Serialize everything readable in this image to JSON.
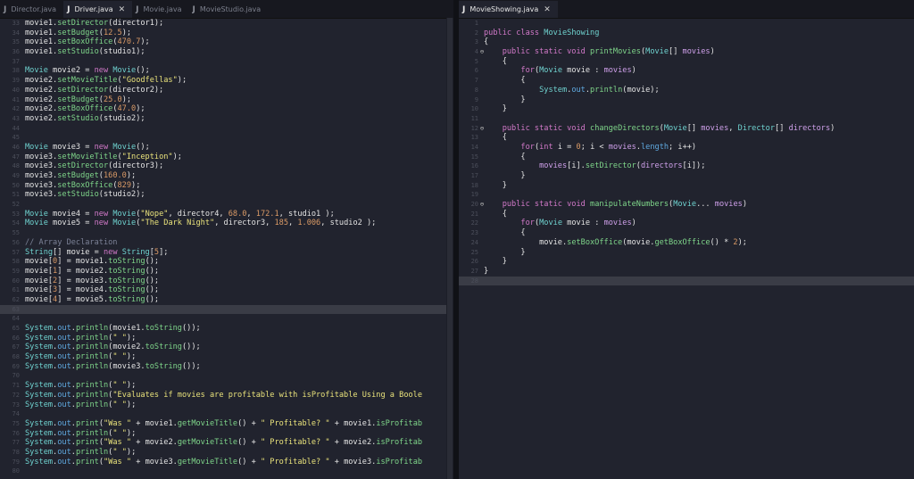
{
  "left_tabs": [
    {
      "label": "Director.java",
      "active": false,
      "close": false
    },
    {
      "label": "Driver.java",
      "active": true,
      "close": true
    },
    {
      "label": "Movie.java",
      "active": false,
      "close": false
    },
    {
      "label": "MovieStudio.java",
      "active": false,
      "close": false
    }
  ],
  "right_tabs": [
    {
      "label": "MovieShowing.java",
      "active": true,
      "close": true
    }
  ],
  "left_code": [
    {
      "n": "33",
      "h": "movie1.<span class=\"f\">setDirector</span>(director1);"
    },
    {
      "n": "34",
      "h": "movie1.<span class=\"f\">setBudget</span>(<span class=\"n\">12.5</span>);"
    },
    {
      "n": "35",
      "h": "movie1.<span class=\"f\">setBoxOffice</span>(<span class=\"n\">470.7</span>);"
    },
    {
      "n": "36",
      "h": "movie1.<span class=\"f\">setStudio</span>(studio1);"
    },
    {
      "n": "37",
      "h": ""
    },
    {
      "n": "38",
      "h": "<span class=\"t\">Movie</span> movie2 = <span class=\"k\">new</span> <span class=\"t\">Movie</span>();"
    },
    {
      "n": "39",
      "h": "movie2.<span class=\"f\">setMovieTitle</span>(<span class=\"s\">\"Goodfellas\"</span>);"
    },
    {
      "n": "40",
      "h": "movie2.<span class=\"f\">setDirector</span>(director2);"
    },
    {
      "n": "41",
      "h": "movie2.<span class=\"f\">setBudget</span>(<span class=\"n\">25.0</span>);"
    },
    {
      "n": "42",
      "h": "movie2.<span class=\"f\">setBoxOffice</span>(<span class=\"n\">47.0</span>);"
    },
    {
      "n": "43",
      "h": "movie2.<span class=\"f\">setStudio</span>(studio2);"
    },
    {
      "n": "44",
      "h": ""
    },
    {
      "n": "45",
      "h": ""
    },
    {
      "n": "46",
      "h": "<span class=\"t\">Movie</span> movie3 = <span class=\"k\">new</span> <span class=\"t\">Movie</span>();"
    },
    {
      "n": "47",
      "h": "movie3.<span class=\"f\">setMovieTitle</span>(<span class=\"s\">\"Inception\"</span>);"
    },
    {
      "n": "48",
      "h": "movie3.<span class=\"f\">setDirector</span>(director3);"
    },
    {
      "n": "49",
      "h": "movie3.<span class=\"f\">setBudget</span>(<span class=\"n\">160.0</span>);"
    },
    {
      "n": "50",
      "h": "movie3.<span class=\"f\">setBoxOffice</span>(<span class=\"n\">829</span>);"
    },
    {
      "n": "51",
      "h": "movie3.<span class=\"f\">setStudio</span>(studio2);"
    },
    {
      "n": "52",
      "h": ""
    },
    {
      "n": "53",
      "h": "<span class=\"t\">Movie</span> movie4 = <span class=\"k\">new</span> <span class=\"t\">Movie</span>(<span class=\"s\">\"Nope\"</span>, director4, <span class=\"n\">68.0</span>, <span class=\"n\">172.1</span>, studio1 );"
    },
    {
      "n": "54",
      "h": "<span class=\"t\">Movie</span> movie5 = <span class=\"k\">new</span> <span class=\"t\">Movie</span>(<span class=\"s\">\"The Dark Night\"</span>, director3, <span class=\"n\">185</span>, <span class=\"n\">1.006</span>, studio2 );"
    },
    {
      "n": "55",
      "h": ""
    },
    {
      "n": "56",
      "h": "<span class=\"c\">// Array Declaration</span>"
    },
    {
      "n": "57",
      "h": "<span class=\"t\">String</span>[] movie = <span class=\"k\">new</span> <span class=\"t\">String</span>[<span class=\"n\">5</span>];"
    },
    {
      "n": "58",
      "h": "movie[<span class=\"n\">0</span>] = movie1.<span class=\"f\">toString</span>();"
    },
    {
      "n": "59",
      "h": "movie[<span class=\"n\">1</span>] = movie2.<span class=\"f\">toString</span>();"
    },
    {
      "n": "60",
      "h": "movie[<span class=\"n\">2</span>] = movie3.<span class=\"f\">toString</span>();"
    },
    {
      "n": "61",
      "h": "movie[<span class=\"n\">3</span>] = movie4.<span class=\"f\">toString</span>();"
    },
    {
      "n": "62",
      "h": "movie[<span class=\"n\">4</span>] = movie5.<span class=\"f\">toString</span>();"
    },
    {
      "n": "63",
      "h": "",
      "hl": true
    },
    {
      "n": "64",
      "h": ""
    },
    {
      "n": "65",
      "h": "<span class=\"t\">System</span>.<span class=\"fld\">out</span>.<span class=\"f\">println</span>(movie1.<span class=\"f\">toString</span>());"
    },
    {
      "n": "66",
      "h": "<span class=\"t\">System</span>.<span class=\"fld\">out</span>.<span class=\"f\">println</span>(<span class=\"s\">\" \"</span>);"
    },
    {
      "n": "67",
      "h": "<span class=\"t\">System</span>.<span class=\"fld\">out</span>.<span class=\"f\">println</span>(movie2.<span class=\"f\">toString</span>());"
    },
    {
      "n": "68",
      "h": "<span class=\"t\">System</span>.<span class=\"fld\">out</span>.<span class=\"f\">println</span>(<span class=\"s\">\" \"</span>);"
    },
    {
      "n": "69",
      "h": "<span class=\"t\">System</span>.<span class=\"fld\">out</span>.<span class=\"f\">println</span>(movie3.<span class=\"f\">toString</span>());"
    },
    {
      "n": "70",
      "h": ""
    },
    {
      "n": "71",
      "h": "<span class=\"t\">System</span>.<span class=\"fld\">out</span>.<span class=\"f\">println</span>(<span class=\"s\">\" \"</span>);"
    },
    {
      "n": "72",
      "h": "<span class=\"t\">System</span>.<span class=\"fld\">out</span>.<span class=\"f\">println</span>(<span class=\"s\">\"Evaluates if movies are profitable with isProfitable Using a Boole</span>"
    },
    {
      "n": "73",
      "h": "<span class=\"t\">System</span>.<span class=\"fld\">out</span>.<span class=\"f\">println</span>(<span class=\"s\">\" \"</span>);"
    },
    {
      "n": "74",
      "h": ""
    },
    {
      "n": "75",
      "h": "<span class=\"t\">System</span>.<span class=\"fld\">out</span>.<span class=\"f\">print</span>(<span class=\"s\">\"Was \"</span> + movie1.<span class=\"f\">getMovieTitle</span>() + <span class=\"s\">\" Profitable? \"</span> + movie1.<span class=\"f\">isProfitab</span>"
    },
    {
      "n": "76",
      "h": "<span class=\"t\">System</span>.<span class=\"fld\">out</span>.<span class=\"f\">println</span>(<span class=\"s\">\" \"</span>);"
    },
    {
      "n": "77",
      "h": "<span class=\"t\">System</span>.<span class=\"fld\">out</span>.<span class=\"f\">print</span>(<span class=\"s\">\"Was \"</span> + movie2.<span class=\"f\">getMovieTitle</span>() + <span class=\"s\">\" Profitable? \"</span> + movie2.<span class=\"f\">isProfitab</span>"
    },
    {
      "n": "78",
      "h": "<span class=\"t\">System</span>.<span class=\"fld\">out</span>.<span class=\"f\">println</span>(<span class=\"s\">\" \"</span>);"
    },
    {
      "n": "79",
      "h": "<span class=\"t\">System</span>.<span class=\"fld\">out</span>.<span class=\"f\">print</span>(<span class=\"s\">\"Was \"</span> + movie3.<span class=\"f\">getMovieTitle</span>() + <span class=\"s\">\" Profitable? \"</span> + movie3.<span class=\"f\">isProfitab</span>"
    },
    {
      "n": "80",
      "h": ""
    }
  ],
  "right_code": [
    {
      "n": "1",
      "h": ""
    },
    {
      "n": "2",
      "h": "<span class=\"k\">public class</span> <span class=\"t\">MovieShowing</span>"
    },
    {
      "n": "3",
      "h": "{"
    },
    {
      "n": "4",
      "h": "    <span class=\"k\">public static void</span> <span class=\"f\">printMovies</span>(<span class=\"t\">Movie</span>[] <span class=\"p\">movies</span>)",
      "fold": true
    },
    {
      "n": "5",
      "h": "    {"
    },
    {
      "n": "6",
      "h": "        <span class=\"k\">for</span>(<span class=\"t\">Movie</span> movie : <span class=\"p\">movies</span>)"
    },
    {
      "n": "7",
      "h": "        {"
    },
    {
      "n": "8",
      "h": "            <span class=\"t\">System</span>.<span class=\"fld\">out</span>.<span class=\"f\">println</span>(movie);"
    },
    {
      "n": "9",
      "h": "        }"
    },
    {
      "n": "10",
      "h": "    }"
    },
    {
      "n": "11",
      "h": ""
    },
    {
      "n": "12",
      "h": "    <span class=\"k\">public static void</span> <span class=\"f\">changeDirectors</span>(<span class=\"t\">Movie</span>[] <span class=\"p\">movies</span>, <span class=\"t\">Director</span>[] <span class=\"p\">directors</span>)",
      "fold": true
    },
    {
      "n": "13",
      "h": "    {"
    },
    {
      "n": "14",
      "h": "        <span class=\"k\">for</span>(<span class=\"k\">int</span> i = <span class=\"n\">0</span>; i &lt; <span class=\"p\">movies</span>.<span class=\"fld\">length</span>; i++)"
    },
    {
      "n": "15",
      "h": "        {"
    },
    {
      "n": "16",
      "h": "            <span class=\"p\">movies</span>[i].<span class=\"f\">setDirector</span>(<span class=\"p\">directors</span>[i]);"
    },
    {
      "n": "17",
      "h": "        }"
    },
    {
      "n": "18",
      "h": "    }"
    },
    {
      "n": "19",
      "h": ""
    },
    {
      "n": "20",
      "h": "    <span class=\"k\">public static void</span> <span class=\"f\">manipulateNumbers</span>(<span class=\"t\">Movie</span>... <span class=\"p\">movies</span>)",
      "fold": true
    },
    {
      "n": "21",
      "h": "    {"
    },
    {
      "n": "22",
      "h": "        <span class=\"k\">for</span>(<span class=\"t\">Movie</span> movie : <span class=\"p\">movies</span>)"
    },
    {
      "n": "23",
      "h": "        {"
    },
    {
      "n": "24",
      "h": "            movie.<span class=\"f\">setBoxOffice</span>(movie.<span class=\"f\">getBoxOffice</span>() * <span class=\"n\">2</span>);"
    },
    {
      "n": "25",
      "h": "        }"
    },
    {
      "n": "26",
      "h": "    }"
    },
    {
      "n": "27",
      "h": "}"
    },
    {
      "n": "28",
      "h": "",
      "hl": true
    }
  ]
}
